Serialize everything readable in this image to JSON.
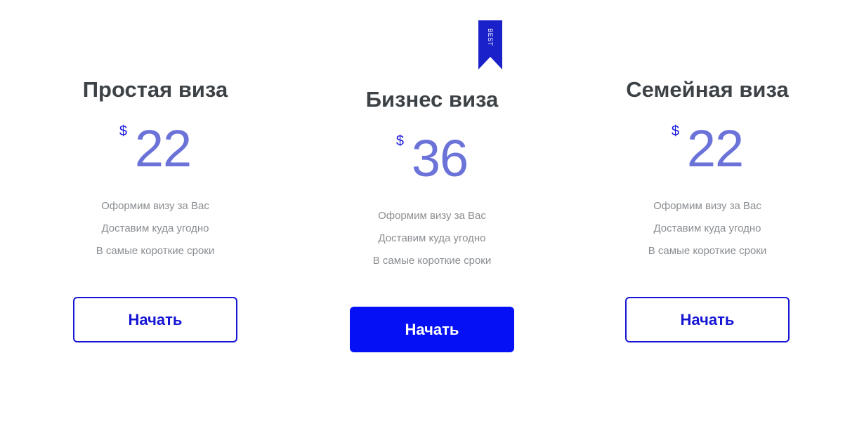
{
  "ribbon": {
    "label": "BEST",
    "color": "#1a21c9"
  },
  "plans": [
    {
      "title": "Простая виза",
      "currency": "$",
      "price": "22",
      "features": [
        "Оформим визу за Вас",
        "Доставим куда угодно",
        "В самые короткие сроки"
      ],
      "button_label": "Начать",
      "button_style": "outline"
    },
    {
      "title": "Бизнес виза",
      "currency": "$",
      "price": "36",
      "features": [
        "Оформим визу за Вас",
        "Доставим куда угодно",
        "В самые короткие сроки"
      ],
      "button_label": "Начать",
      "button_style": "filled"
    },
    {
      "title": "Семейная виза",
      "currency": "$",
      "price": "22",
      "features": [
        "Оформим визу за Вас",
        "Доставим куда угодно",
        "В самые короткие сроки"
      ],
      "button_label": "Начать",
      "button_style": "outline"
    }
  ],
  "colors": {
    "title": "#3d4247",
    "price": "#6b72d8",
    "currency": "#1a1ad8",
    "feature_text": "#8a8e92",
    "button_outline": "#1515d4",
    "button_filled": "#0510f5"
  }
}
